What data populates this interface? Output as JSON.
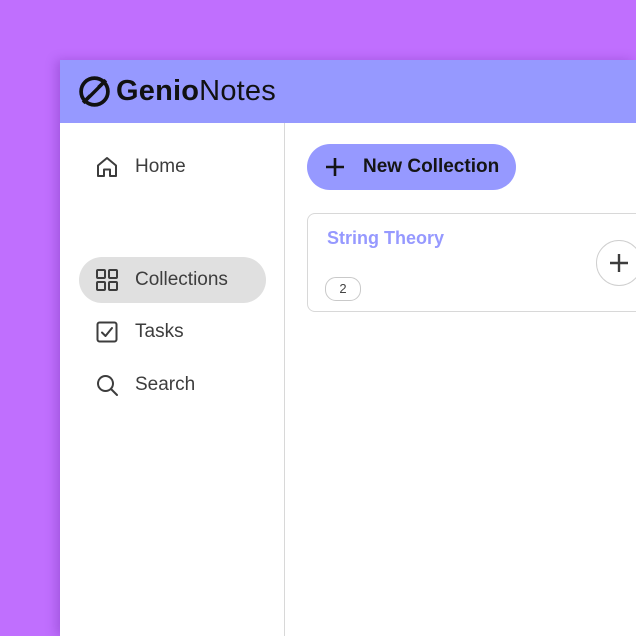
{
  "app": {
    "brand_bold": "Genio",
    "brand_regular": "Notes",
    "logo_icon": "genio-logo-icon",
    "accent_color": "#9699ff",
    "background_color": "#c06ffe"
  },
  "sidebar": {
    "items": [
      {
        "label": "Home",
        "icon": "home-icon",
        "active": false
      },
      {
        "label": "Collections",
        "icon": "grid-icon",
        "active": true
      },
      {
        "label": "Tasks",
        "icon": "checkbox-icon",
        "active": false
      },
      {
        "label": "Search",
        "icon": "search-icon",
        "active": false
      }
    ]
  },
  "main": {
    "new_collection_label": "New Collection",
    "collections": [
      {
        "title": "String Theory",
        "count": "2"
      }
    ]
  }
}
